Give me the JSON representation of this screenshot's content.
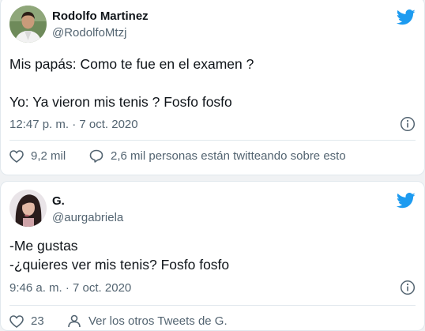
{
  "tweets": [
    {
      "author": {
        "name": "Rodolfo Martinez",
        "handle": "@RodolfoMtzj"
      },
      "lines": [
        "Mis papás: Como te fue en el examen ?",
        "Yo: Ya vieron mis tenis ? Fosfo fosfo"
      ],
      "timestamp": "12:47 p. m. · 7 oct. 2020",
      "likes": "9,2 mil",
      "activity": "2,6 mil personas están twitteando sobre esto"
    },
    {
      "author": {
        "name": "G.",
        "handle": "@aurgabriela"
      },
      "lines": [
        "-Me gustas",
        "-¿quieres ver mis tenis? Fosfo fosfo"
      ],
      "timestamp": "9:46 a. m. · 7 oct. 2020",
      "likes": "23",
      "activity": "Ver los otros Tweets de G."
    }
  ],
  "colors": {
    "twitter_blue": "#1d9bf0",
    "text_primary": "#0f1419",
    "text_secondary": "#536471",
    "border": "#e1e8ed"
  },
  "icons": [
    "twitter-bird-icon",
    "info-icon",
    "heart-icon",
    "speech-bubble-icon",
    "person-icon"
  ]
}
